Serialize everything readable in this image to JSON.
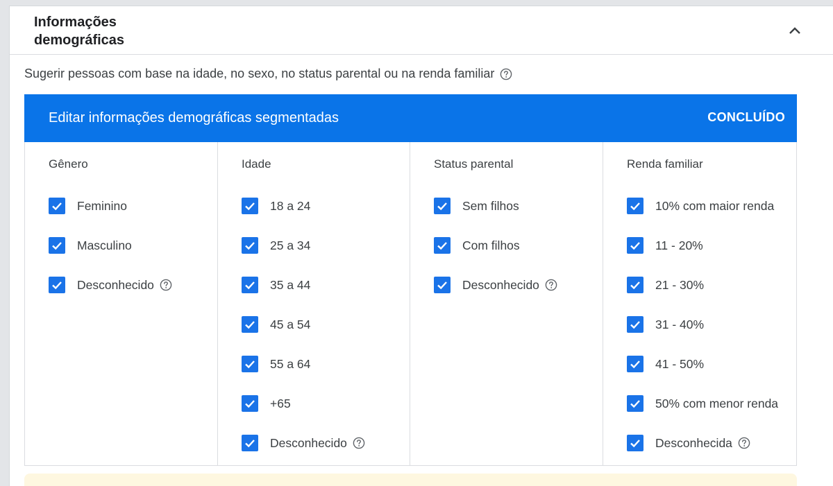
{
  "section": {
    "title": "Informações demográficas",
    "description": "Sugerir pessoas com base na idade, no sexo, no status parental ou na renda familiar"
  },
  "edit_panel": {
    "title": "Editar informações demográficas segmentadas",
    "done_label": "CONCLUÍDO"
  },
  "columns": {
    "gender": {
      "title": "Gênero",
      "options": [
        {
          "label": "Feminino",
          "checked": true
        },
        {
          "label": "Masculino",
          "checked": true
        },
        {
          "label": "Desconhecido",
          "checked": true
        }
      ]
    },
    "age": {
      "title": "Idade",
      "options": [
        {
          "label": "18 a 24",
          "checked": true
        },
        {
          "label": "25 a 34",
          "checked": true
        },
        {
          "label": "35 a 44",
          "checked": true
        },
        {
          "label": "45 a 54",
          "checked": true
        },
        {
          "label": "55 a 64",
          "checked": true
        },
        {
          "label": "+65",
          "checked": true
        },
        {
          "label": "Desconhecido",
          "checked": true
        }
      ]
    },
    "parental": {
      "title": "Status parental",
      "options": [
        {
          "label": "Sem filhos",
          "checked": true
        },
        {
          "label": "Com filhos",
          "checked": true
        },
        {
          "label": "Desconhecido",
          "checked": true
        }
      ]
    },
    "income": {
      "title": "Renda familiar",
      "options": [
        {
          "label": "10% com maior renda",
          "checked": true
        },
        {
          "label": "11 - 20%",
          "checked": true
        },
        {
          "label": "21 - 30%",
          "checked": true
        },
        {
          "label": "31 - 40%",
          "checked": true
        },
        {
          "label": "41 - 50%",
          "checked": true
        },
        {
          "label": "50% com menor renda",
          "checked": true
        },
        {
          "label": "Desconhecida",
          "checked": true
        }
      ]
    }
  },
  "colors": {
    "blue_bar": "#0a74e8",
    "checkbox": "#1a73e8",
    "notice_background": "#fef7e0"
  },
  "icons": {
    "collapse": "chevron-up-icon",
    "help": "help-circle-icon",
    "check": "check-icon"
  }
}
